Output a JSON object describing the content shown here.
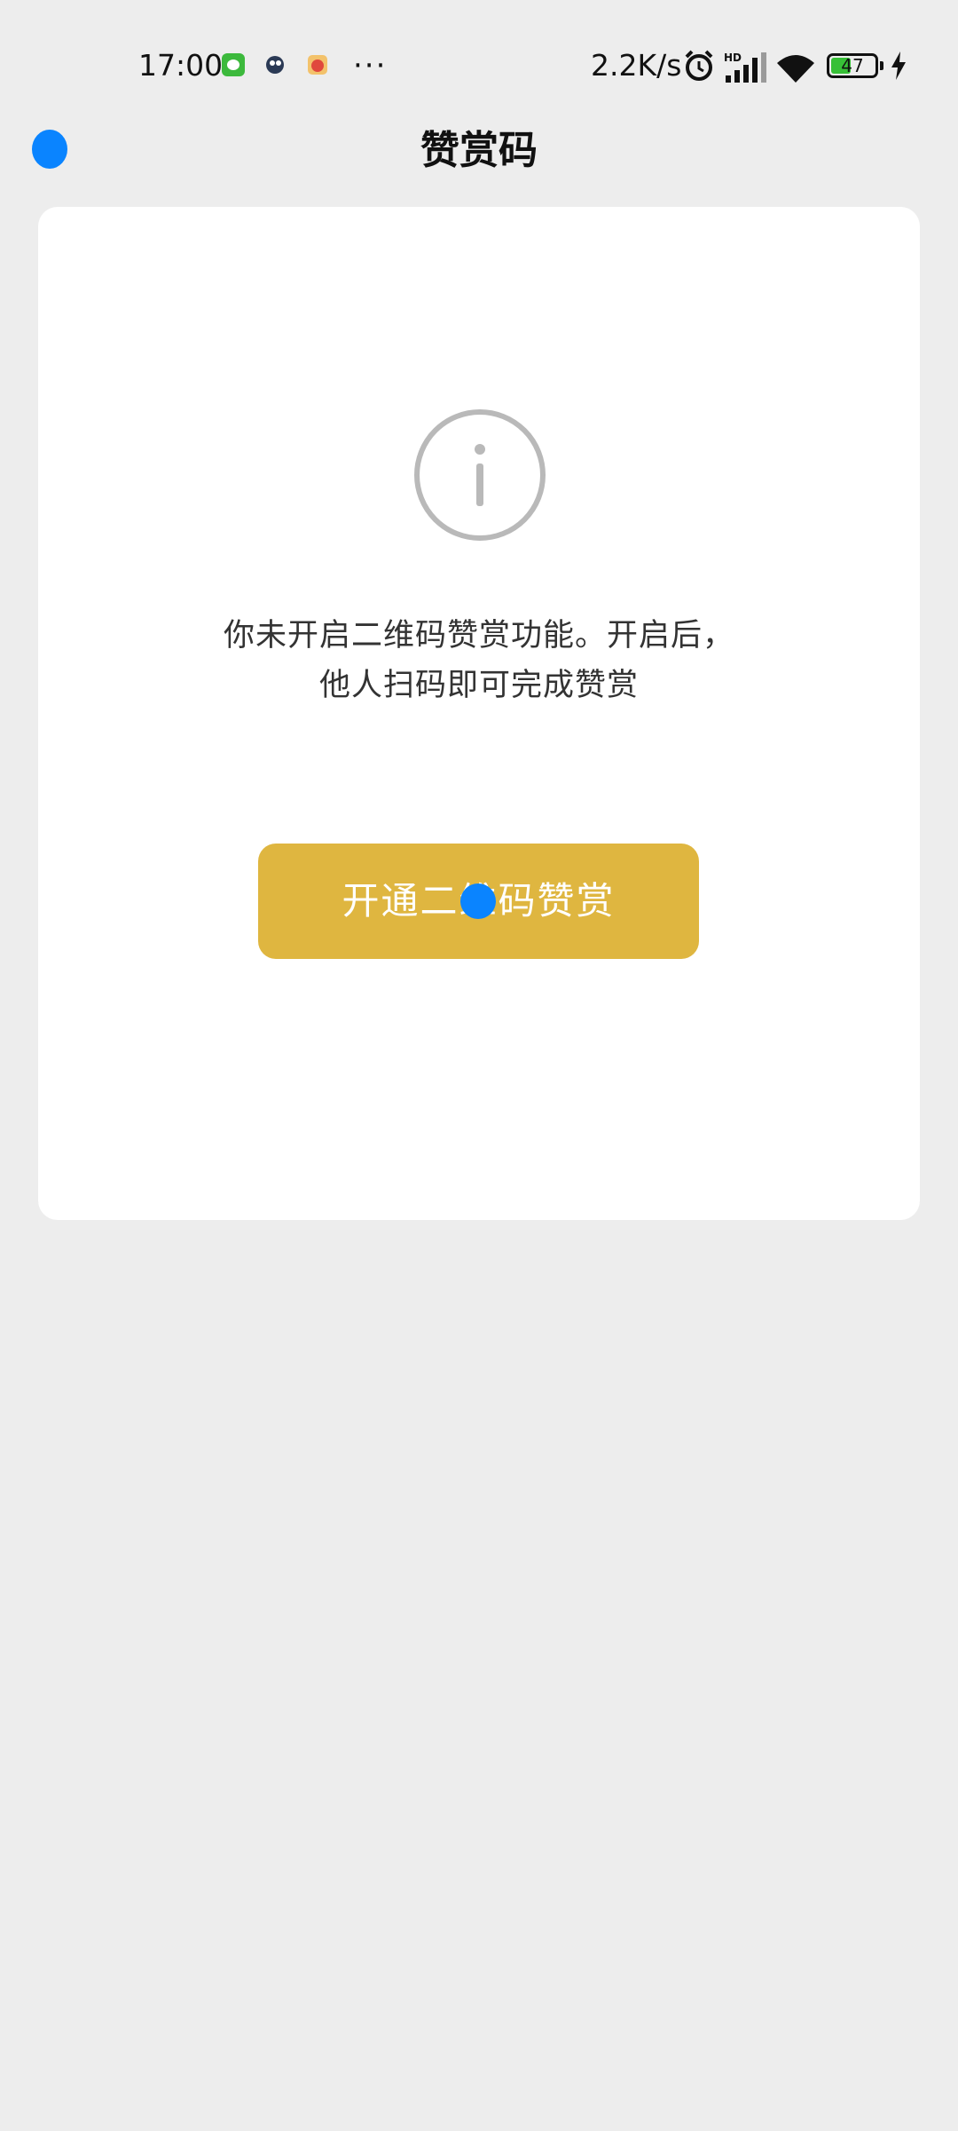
{
  "status_bar": {
    "time": "17:00",
    "more": "···",
    "net_speed": "2.2K/s",
    "hd_label": "HD",
    "battery_level": "47",
    "icons": [
      "wechat-app-icon",
      "app-icon-2",
      "app-icon-3",
      "alarm-icon",
      "signal-icon",
      "wifi-icon",
      "battery-icon",
      "charging-icon"
    ]
  },
  "header": {
    "title": "赞赏码"
  },
  "card": {
    "message_line1": "你未开启二维码赞赏功能。开启后，",
    "message_line2": "他人扫码即可完成赞赏",
    "button_label": "开通二维码赞赏",
    "icon": "info-icon"
  },
  "colors": {
    "background": "#ededed",
    "card": "#ffffff",
    "button": "#dfb640",
    "touch_indicator": "#0a84ff"
  }
}
